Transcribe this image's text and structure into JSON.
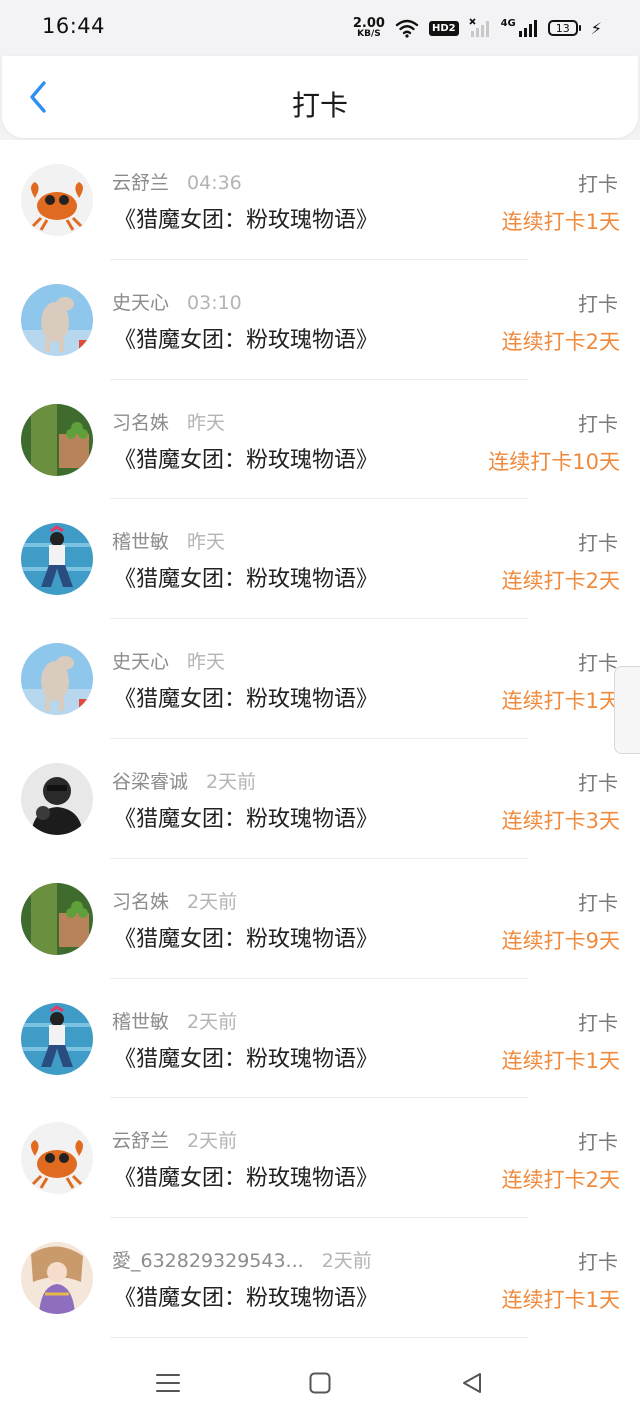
{
  "status_bar": {
    "time": "16:44",
    "net_speed": "2.00",
    "net_unit": "KB/S",
    "hd_label": "HD2",
    "signal_label": "4G",
    "battery": "13"
  },
  "header": {
    "title": "打卡"
  },
  "colors": {
    "accent": "#f08a3c",
    "back": "#2d8ff0",
    "name": "#8c8c8c"
  },
  "records": [
    {
      "name": "云舒兰",
      "time": "04:36",
      "book": "《猎魔女团：粉玫瑰物语》",
      "action": "打卡",
      "streak": "连续打卡1天",
      "avatar": "crab-avatar"
    },
    {
      "name": "史天心",
      "time": "03:10",
      "book": "《猎魔女团：粉玫瑰物语》",
      "action": "打卡",
      "streak": "连续打卡2天",
      "avatar": "pig-avatar"
    },
    {
      "name": "习名姝",
      "time": "昨天",
      "book": "《猎魔女团：粉玫瑰物语》",
      "action": "打卡",
      "streak": "连续打卡10天",
      "avatar": "plant-avatar"
    },
    {
      "name": "稽世敏",
      "time": "昨天",
      "book": "《猎魔女团：粉玫瑰物语》",
      "action": "打卡",
      "streak": "连续打卡2天",
      "avatar": "girl-avatar"
    },
    {
      "name": "史天心",
      "time": "昨天",
      "book": "《猎魔女团：粉玫瑰物语》",
      "action": "打卡",
      "streak": "连续打卡1天",
      "avatar": "pig-avatar"
    },
    {
      "name": "谷梁睿诚",
      "time": "2天前",
      "book": "《猎魔女团：粉玫瑰物语》",
      "action": "打卡",
      "streak": "连续打卡3天",
      "avatar": "bw-person-avatar"
    },
    {
      "name": "习名姝",
      "time": "2天前",
      "book": "《猎魔女团：粉玫瑰物语》",
      "action": "打卡",
      "streak": "连续打卡9天",
      "avatar": "plant-avatar"
    },
    {
      "name": "稽世敏",
      "time": "2天前",
      "book": "《猎魔女团：粉玫瑰物语》",
      "action": "打卡",
      "streak": "连续打卡1天",
      "avatar": "girl-avatar"
    },
    {
      "name": "云舒兰",
      "time": "2天前",
      "book": "《猎魔女团：粉玫瑰物语》",
      "action": "打卡",
      "streak": "连续打卡2天",
      "avatar": "crab-avatar"
    },
    {
      "name": "愛_632829329543...",
      "time": "2天前",
      "book": "《猎魔女团：粉玫瑰物语》",
      "action": "打卡",
      "streak": "连续打卡1天",
      "avatar": "anime-avatar"
    }
  ],
  "nav": {
    "menu_icon": "menu-icon",
    "home_icon": "home-icon",
    "back_icon": "back-triangle-icon"
  }
}
